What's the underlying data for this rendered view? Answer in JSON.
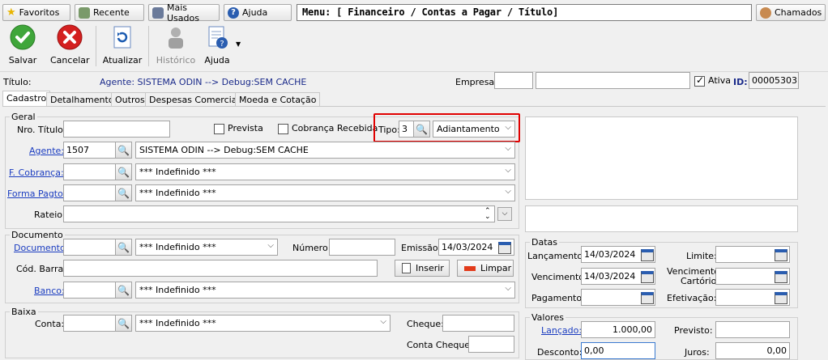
{
  "toolbar_top": {
    "favoritos": "Favoritos",
    "recente": "Recente",
    "mais_usados": "Mais Usados",
    "ajuda": "Ajuda",
    "menu_path": "Menu: [ Financeiro / Contas a Pagar / Título]",
    "chamados": "Chamados"
  },
  "actions": {
    "salvar": "Salvar",
    "cancelar": "Cancelar",
    "atualizar": "Atualizar",
    "historico": "Histórico",
    "ajuda": "Ajuda"
  },
  "header": {
    "titulo_label": "Título:",
    "agente_text": "Agente: SISTEMA ODIN --> Debug:SEM CACHE",
    "empresa_label": "Empresa:",
    "empresa_code": "",
    "empresa_name": "",
    "ativa_label": "Ativa",
    "id_label": "ID:",
    "id_value": "00005303"
  },
  "tabs": [
    "Cadastro",
    "Detalhamento",
    "Outros",
    "Despesas Comerciais",
    "Moeda e Cotação"
  ],
  "geral": {
    "title": "Geral",
    "nro_titulo_label": "Nro. Título:",
    "nro_titulo_value": "",
    "prevista_label": "Prevista",
    "cobranca_recebida_label": "Cobrança Recebida",
    "tipo_label": "Tipo:",
    "tipo_code": "3",
    "tipo_value": "Adiantamento",
    "agente_label": "Agente:",
    "agente_code": "1507",
    "agente_value": "SISTEMA ODIN --> Debug:SEM CACHE",
    "f_cobranca_label": "F. Cobrança:",
    "f_cobranca_value": "*** Indefinido ***",
    "forma_pagto_label": "Forma Pagto:",
    "forma_pagto_value": "*** Indefinido ***",
    "rateio_label": "Rateio:"
  },
  "documento": {
    "title": "Documento",
    "documento_label": "Documento:",
    "documento_value": "*** Indefinido ***",
    "numero_label": "Número:",
    "numero_value": "",
    "emissao_label": "Emissão:",
    "emissao_value": "14/03/2024",
    "cod_barra_label": "Cód. Barra:",
    "inserir_label": "Inserir",
    "limpar_label": "Limpar",
    "banco_label": "Banco:",
    "banco_value": "*** Indefinido ***"
  },
  "baixa": {
    "title": "Baixa",
    "conta_label": "Conta:",
    "conta_value": "*** Indefinido ***",
    "cheque_label": "Cheque:",
    "conta_cheque_label": "Conta Cheque:"
  },
  "datas": {
    "title": "Datas",
    "lancamento_label": "Lançamento:",
    "lancamento_value": "14/03/2024",
    "vencimento_label": "Vencimento:",
    "vencimento_value": "14/03/2024",
    "pagamento_label": "Pagamento:",
    "limite_label": "Limite:",
    "venc_cartorio_label_1": "Vencimento",
    "venc_cartorio_label_2": "Cartório:",
    "efetivacao_label": "Efetivação:"
  },
  "valores": {
    "title": "Valores",
    "lancado_label": "Lançado:",
    "lancado_value": "1.000,00",
    "previsto_label": "Previsto:",
    "previsto_value": "",
    "desconto_label": "Desconto:",
    "desconto_value": "0,00",
    "juros_label": "Juros:",
    "juros_value": "0,00"
  },
  "colors": {
    "link": "#1a3cc0",
    "highlight": "#e00000",
    "header_agent": "#1a2a8a"
  }
}
